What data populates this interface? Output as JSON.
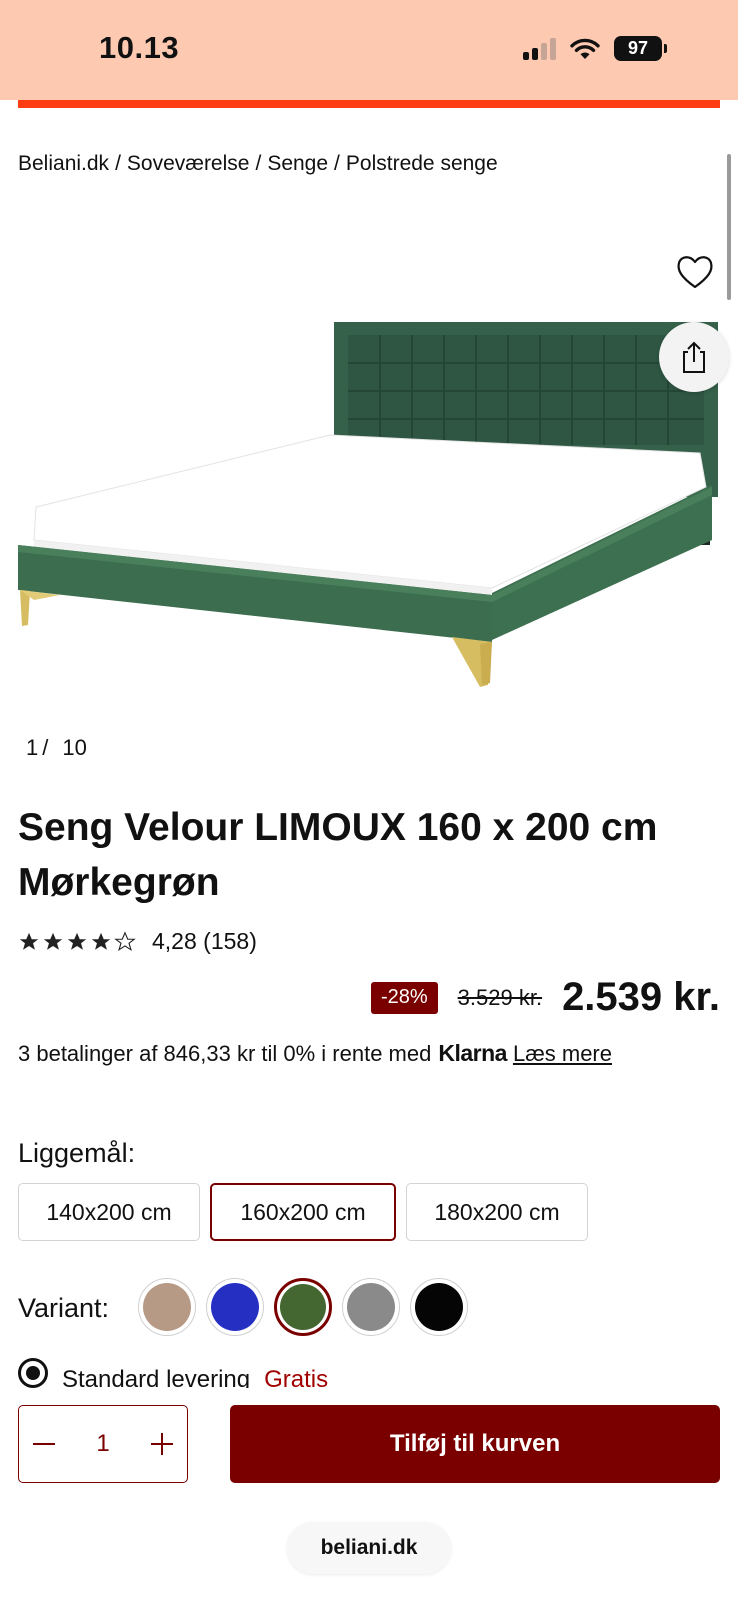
{
  "status_bar": {
    "time": "10.13",
    "battery": "97"
  },
  "breadcrumb": {
    "items": [
      "Beliani.dk",
      "Soveværelse",
      "Senge",
      "Polstrede senge"
    ],
    "separator": "/"
  },
  "gallery": {
    "current": "1",
    "separator": "/",
    "total": "10",
    "favorite_icon": "heart-icon",
    "share_icon": "share-icon",
    "frame_color": "#3c6b4c",
    "leg_color": "#d6bd62"
  },
  "product": {
    "title_line1": "Seng Velour LIMOUX 160 x 200 cm",
    "title_line2": "Mørkegrøn",
    "rating_stars": 4.28,
    "rating_text": "4,28 (158)",
    "discount": "-28%",
    "old_price": "3.529  kr.",
    "price": "2.539 kr.",
    "installments": {
      "text": "3 betalinger af 846,33 kr til 0% i rente med",
      "brand": "Klarna",
      "link": "Læs mere"
    }
  },
  "options": {
    "size_label": "Liggemål:",
    "sizes": [
      {
        "label": "140x200 cm",
        "selected": false
      },
      {
        "label": "160x200 cm",
        "selected": true
      },
      {
        "label": "180x200 cm",
        "selected": false
      }
    ],
    "variant_label": "Variant:",
    "variants": [
      {
        "color": "#b79a85",
        "selected": false
      },
      {
        "color": "#2530c3",
        "selected": false
      },
      {
        "color": "#446630",
        "selected": true
      },
      {
        "color": "#8a8a8a",
        "selected": false
      },
      {
        "color": "#050505",
        "selected": false
      }
    ]
  },
  "delivery": {
    "label": "Standard levering",
    "price": "Gratis"
  },
  "cart": {
    "quantity": "1",
    "add_label": "Tilføj til kurven"
  },
  "url_bar": {
    "domain": "beliani.dk"
  },
  "colors": {
    "accent": "#ff3d12",
    "brand": "#7a0000",
    "status_bar": "#fdc9b1"
  }
}
